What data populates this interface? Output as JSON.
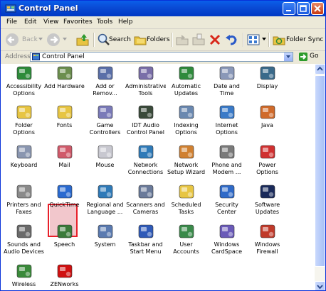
{
  "window": {
    "title": "Control Panel"
  },
  "menu": [
    "File",
    "Edit",
    "View",
    "Favorites",
    "Tools",
    "Help"
  ],
  "toolbar": {
    "back": "Back",
    "search": "Search",
    "folders": "Folders",
    "folder_sync": "Folder Sync"
  },
  "address": {
    "label": "Address",
    "value": "Control Panel",
    "go": "Go"
  },
  "items": [
    {
      "label": "Accessibility Options",
      "icon": "accessibility-icon",
      "color": "#2E8B3A"
    },
    {
      "label": "Add Hardware",
      "icon": "add-hardware-icon",
      "color": "#6B8E4E"
    },
    {
      "label": "Add or Remov...",
      "icon": "add-remove-programs-icon",
      "color": "#5A6FA8"
    },
    {
      "label": "Administrative Tools",
      "icon": "administrative-tools-icon",
      "color": "#7A6FA8"
    },
    {
      "label": "Automatic Updates",
      "icon": "automatic-updates-icon",
      "color": "#2F8A3C"
    },
    {
      "label": "Date and Time",
      "icon": "date-time-icon",
      "color": "#8A98B8"
    },
    {
      "label": "Display",
      "icon": "display-icon",
      "color": "#3A6A8A"
    },
    {
      "label": "Folder Options",
      "icon": "folder-options-icon",
      "color": "#E7C543"
    },
    {
      "label": "Fonts",
      "icon": "fonts-icon",
      "color": "#E7C543"
    },
    {
      "label": "Game Controllers",
      "icon": "game-controllers-icon",
      "color": "#7A7AB8"
    },
    {
      "label": "IDT Audio Control Panel",
      "icon": "idt-audio-icon",
      "color": "#3A4A3A"
    },
    {
      "label": "Indexing Options",
      "icon": "indexing-options-icon",
      "color": "#6A88B0"
    },
    {
      "label": "Internet Options",
      "icon": "internet-options-icon",
      "color": "#3A7AC8"
    },
    {
      "label": "Java",
      "icon": "java-icon",
      "color": "#D06A2A"
    },
    {
      "label": "Keyboard",
      "icon": "keyboard-icon",
      "color": "#8A96B0"
    },
    {
      "label": "Mail",
      "icon": "mail-icon",
      "color": "#D05A6A"
    },
    {
      "label": "Mouse",
      "icon": "mouse-icon",
      "color": "#C8C8D0"
    },
    {
      "label": "Network Connections",
      "icon": "network-connections-icon",
      "color": "#2F7AB8"
    },
    {
      "label": "Network Setup Wizard",
      "icon": "network-setup-wizard-icon",
      "color": "#D08030"
    },
    {
      "label": "Phone and Modem ...",
      "icon": "phone-modem-icon",
      "color": "#7A7A7A"
    },
    {
      "label": "Power Options",
      "icon": "power-options-icon",
      "color": "#D03030"
    },
    {
      "label": "Printers and Faxes",
      "icon": "printers-faxes-icon",
      "color": "#8A8A8A"
    },
    {
      "label": "QuickTime",
      "icon": "quicktime-icon",
      "color": "#2A6AD0"
    },
    {
      "label": "Regional and Language ...",
      "icon": "regional-language-icon",
      "color": "#2F7AB8"
    },
    {
      "label": "Scanners and Cameras",
      "icon": "scanners-cameras-icon",
      "color": "#6A7A9A"
    },
    {
      "label": "Scheduled Tasks",
      "icon": "scheduled-tasks-icon",
      "color": "#E7C543"
    },
    {
      "label": "Security Center",
      "icon": "security-center-icon",
      "color": "#2F6AC8"
    },
    {
      "label": "Software Updates",
      "icon": "software-updates-icon",
      "color": "#1A2A5A"
    },
    {
      "label": "Sounds and Audio Devices",
      "icon": "sounds-audio-icon",
      "color": "#6A6A6A"
    },
    {
      "label": "Speech",
      "icon": "speech-icon",
      "color": "#3A7A3A"
    },
    {
      "label": "System",
      "icon": "system-icon",
      "color": "#5A7AB0"
    },
    {
      "label": "Taskbar and Start Menu",
      "icon": "taskbar-start-menu-icon",
      "color": "#2F5AB8"
    },
    {
      "label": "User Accounts",
      "icon": "user-accounts-icon",
      "color": "#3A8A4A"
    },
    {
      "label": "Windows CardSpace",
      "icon": "windows-cardspace-icon",
      "color": "#6A5AB8"
    },
    {
      "label": "Windows Firewall",
      "icon": "windows-firewall-icon",
      "color": "#C03A2A"
    },
    {
      "label": "Wireless",
      "icon": "wireless-icon",
      "color": "#3A8A3A"
    },
    {
      "label": "ZENworks",
      "icon": "zenworks-icon",
      "color": "#D01010"
    }
  ],
  "selected_item": "Mail"
}
